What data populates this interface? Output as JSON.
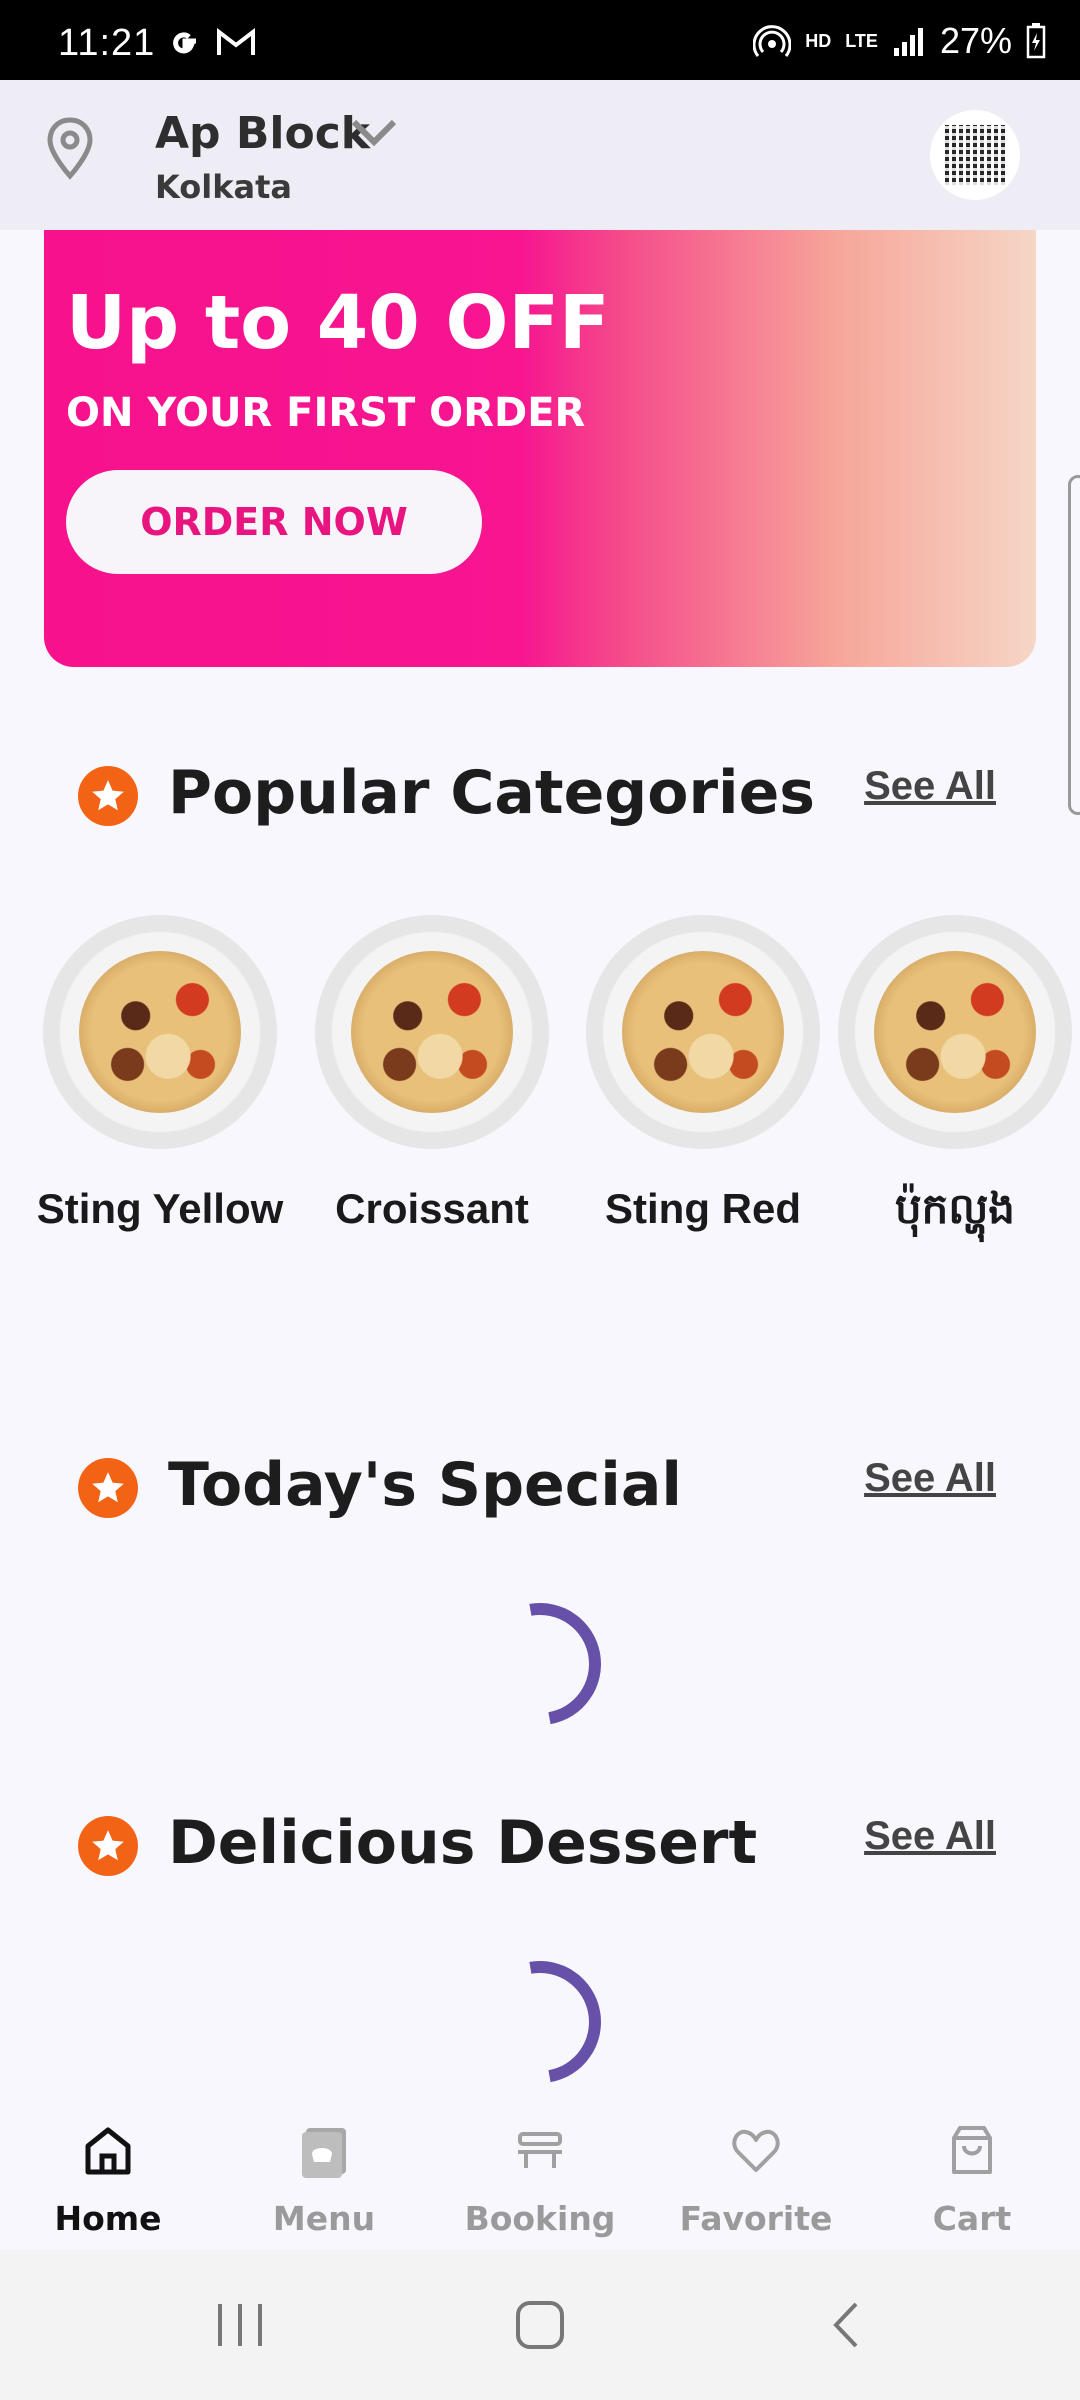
{
  "status_bar": {
    "time": "11:21",
    "left_icons": [
      "google-g-icon",
      "gmail-icon"
    ],
    "hd_label": "HD",
    "lte_label": "LTE",
    "battery": "27%"
  },
  "header": {
    "location_title": "Ap Block",
    "location_subtitle": "Kolkata"
  },
  "banner": {
    "title": "Up to 40 OFF",
    "subtitle": "ON YOUR FIRST ORDER",
    "button_label": "ORDER NOW",
    "colors": {
      "start": "#f7118d",
      "end": "#f6d6c6"
    }
  },
  "popular": {
    "title": "Popular Categories",
    "see_all": "See All",
    "items": [
      {
        "label": "Sting Yellow"
      },
      {
        "label": "Croissant"
      },
      {
        "label": "Sting Red"
      },
      {
        "label": "ប៉ុកល្ហុង"
      }
    ]
  },
  "special": {
    "title": "Today's Special",
    "see_all": "See All"
  },
  "dessert": {
    "title": "Delicious Dessert",
    "see_all": "See All"
  },
  "bottom_nav": {
    "items": [
      {
        "label": "Home",
        "icon": "home-icon",
        "active": true
      },
      {
        "label": "Menu",
        "icon": "menu-book-icon",
        "active": false
      },
      {
        "label": "Booking",
        "icon": "table-icon",
        "active": false
      },
      {
        "label": "Favorite",
        "icon": "heart-icon",
        "active": false
      },
      {
        "label": "Cart",
        "icon": "bag-icon",
        "active": false
      }
    ]
  },
  "accent_colors": {
    "star": "#f26316",
    "spinner": "#6751a8",
    "banner_button_text": "#e8147f"
  }
}
